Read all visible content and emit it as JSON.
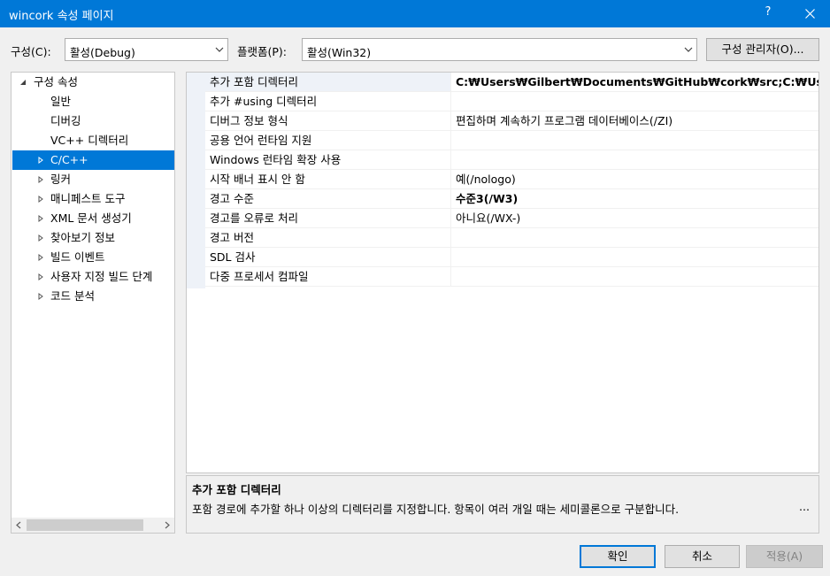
{
  "window": {
    "title": "wincork 속성 페이지",
    "help_label": "?",
    "accent_color": "#0078d7"
  },
  "toolbar": {
    "config_label": "구성(C):",
    "config_value": "활성(Debug)",
    "platform_label": "플랫폼(P):",
    "platform_value": "활성(Win32)",
    "manager_label": "구성 관리자(O)..."
  },
  "tree": {
    "items": [
      {
        "label": "구성 속성",
        "expanded": true
      },
      {
        "label": "일반"
      },
      {
        "label": "디버깅"
      },
      {
        "label": "VC++ 디렉터리"
      },
      {
        "label": "C/C++",
        "selected": true
      },
      {
        "label": "링커"
      },
      {
        "label": "매니페스트 도구"
      },
      {
        "label": "XML 문서 생성기"
      },
      {
        "label": "찾아보기 정보"
      },
      {
        "label": "빌드 이벤트"
      },
      {
        "label": "사용자 지정 빌드 단계"
      },
      {
        "label": "코드 분석"
      }
    ]
  },
  "grid": {
    "rows": [
      {
        "name": "추가 포함 디렉터리",
        "value": "C:₩Users₩Gilbert₩Documents₩GitHub₩cork₩src;C:₩Users₩Gilbert₩Documents",
        "bold": true,
        "selected": true
      },
      {
        "name": "추가 #using 디렉터리",
        "value": ""
      },
      {
        "name": "디버그 정보 형식",
        "value": "편집하며 계속하기 프로그램 데이터베이스(/ZI)"
      },
      {
        "name": "공용 언어 런타임 지원",
        "value": ""
      },
      {
        "name": "Windows 런타임 확장 사용",
        "value": ""
      },
      {
        "name": "시작 배너 표시 안 함",
        "value": "예(/nologo)"
      },
      {
        "name": "경고 수준",
        "value": "수준3(/W3)",
        "bold": true
      },
      {
        "name": "경고를 오류로 처리",
        "value": "아니요(/WX-)"
      },
      {
        "name": "경고 버전",
        "value": ""
      },
      {
        "name": "SDL 검사",
        "value": ""
      },
      {
        "name": "다중 프로세서 컴파일",
        "value": ""
      }
    ]
  },
  "description": {
    "title": "추가 포함 디렉터리",
    "text": "포함 경로에 추가할 하나 이상의 디렉터리를 지정합니다. 항목이 여러 개일 때는 세미콜론으로 구분합니다.",
    "more": "..."
  },
  "buttons": {
    "ok": "확인",
    "cancel": "취소",
    "apply": "적용(A)"
  }
}
